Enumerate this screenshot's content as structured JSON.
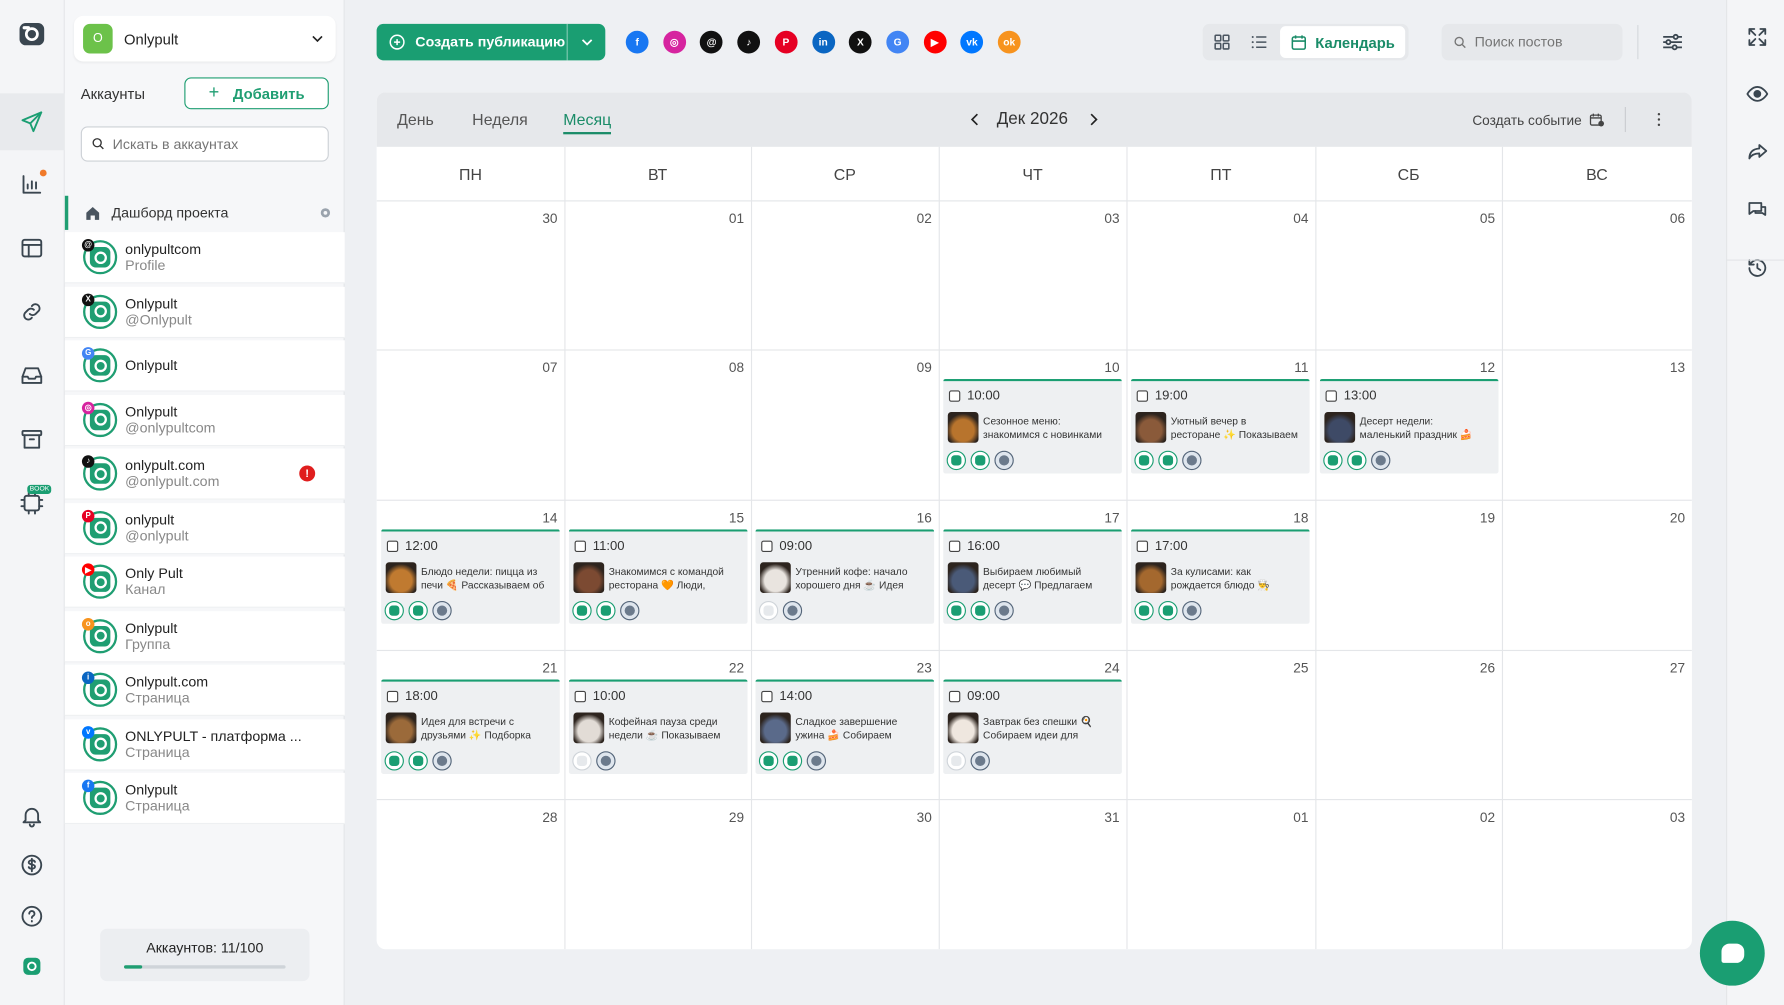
{
  "colors": {
    "accent": "#1a9e72",
    "warning": "#e01e1e"
  },
  "rail": {
    "items": [
      "logo-icon",
      "send-icon",
      "stats-icon",
      "layout-icon",
      "link-icon",
      "inbox-icon",
      "archive-icon",
      "ai-icon",
      "bell-icon",
      "dollar-icon",
      "help-icon",
      "app-icon"
    ],
    "ai_badge": "BOOK"
  },
  "project": {
    "name": "Onlypult",
    "avatar": "O"
  },
  "accounts_panel": {
    "label": "Аккаунты",
    "add_label": "Добавить",
    "search_placeholder": "Искать в аккаунтах",
    "dashboard_label": "Дашборд проекта",
    "items": [
      {
        "name": "onlypultcom",
        "sub": "Profile",
        "network": "threads"
      },
      {
        "name": "Onlypult",
        "sub": "@Onlypult",
        "network": "x"
      },
      {
        "name": "Onlypult",
        "sub": "",
        "network": "google"
      },
      {
        "name": "Onlypult",
        "sub": "@onlypultcom",
        "network": "instagram"
      },
      {
        "name": "onlypult.com",
        "sub": "@onlypult.com",
        "network": "tiktok",
        "warning": "!"
      },
      {
        "name": "onlypult",
        "sub": "@onlypult",
        "network": "pinterest"
      },
      {
        "name": "Only Pult",
        "sub": "Канал",
        "network": "youtube"
      },
      {
        "name": "Onlypult",
        "sub": "Группа",
        "network": "ok"
      },
      {
        "name": "Onlypult.com",
        "sub": "Страница",
        "network": "linkedin"
      },
      {
        "name": "ONLYPULT - платформа ...",
        "sub": "Страница",
        "network": "vk"
      },
      {
        "name": "Onlypult",
        "sub": "Страница",
        "network": "facebook"
      }
    ],
    "quota_label": "Аккаунтов: 11/100",
    "quota_fraction": 0.11
  },
  "toolbar": {
    "create_label": "Создать публикацию",
    "networks": [
      "facebook",
      "instagram",
      "threads",
      "tiktok",
      "pinterest",
      "linkedin",
      "x",
      "google",
      "youtube",
      "vk",
      "ok"
    ],
    "calendar_label": "Календарь",
    "search_placeholder": "Поиск постов"
  },
  "calendar": {
    "tabs": [
      "День",
      "Неделя",
      "Месяц"
    ],
    "active_tab": "Месяц",
    "month_label": "Дек 2026",
    "create_event_label": "Создать событие",
    "weekdays": [
      "ПН",
      "ВТ",
      "СР",
      "ЧТ",
      "ПТ",
      "СБ",
      "ВС"
    ],
    "weeks": [
      [
        "30",
        "01",
        "02",
        "03",
        "04",
        "05",
        "06"
      ],
      [
        "07",
        "08",
        "09",
        "10",
        "11",
        "12",
        "13"
      ],
      [
        "14",
        "15",
        "16",
        "17",
        "18",
        "19",
        "20"
      ],
      [
        "21",
        "22",
        "23",
        "24",
        "25",
        "26",
        "27"
      ],
      [
        "28",
        "29",
        "30",
        "31",
        "01",
        "02",
        "03"
      ]
    ],
    "posts": [
      {
        "week": 1,
        "day": 3,
        "time": "10:00",
        "text": "Сезонное меню: знакомимся с новинками 🍕 Пок...",
        "icons": [
          "g",
          "g",
          "owl"
        ]
      },
      {
        "week": 1,
        "day": 4,
        "time": "19:00",
        "text": "Уютный вечер в ресторане ✨ Показываем интер...",
        "icons": [
          "g",
          "g",
          "owl"
        ]
      },
      {
        "week": 1,
        "day": 5,
        "time": "13:00",
        "text": "Десерт недели: маленький праздник 🍰 Показыв...",
        "icons": [
          "g",
          "g",
          "owl"
        ]
      },
      {
        "week": 2,
        "day": 0,
        "time": "12:00",
        "text": "Блюдо недели: пицца из печи 🍕 Рассказываем об ...",
        "icons": [
          "g",
          "g",
          "owl"
        ]
      },
      {
        "week": 2,
        "day": 1,
        "time": "11:00",
        "text": "Знакомимся с командой ресторана 🧡 Люди, кото...",
        "icons": [
          "g",
          "g",
          "owl"
        ]
      },
      {
        "week": 2,
        "day": 2,
        "time": "09:00",
        "text": "Утренний кофе: начало хорошего дня ☕ Идея для...",
        "icons": [
          "logo",
          "owl"
        ]
      },
      {
        "week": 2,
        "day": 3,
        "time": "16:00",
        "text": "Выбираем любимый десерт 💬 Предлагаем гостя...",
        "icons": [
          "g",
          "g",
          "owl"
        ]
      },
      {
        "week": 2,
        "day": 4,
        "time": "17:00",
        "text": "За кулисами: как рождается блюдо 👨‍🍳 Рассказыв...",
        "icons": [
          "g",
          "g",
          "owl"
        ]
      },
      {
        "week": 3,
        "day": 0,
        "time": "18:00",
        "text": "Идея для встречи с друзьями ✨ Подборка уютны...",
        "icons": [
          "g",
          "g",
          "owl"
        ]
      },
      {
        "week": 3,
        "day": 1,
        "time": "10:00",
        "text": "Кофейная пауза среди недели ☕ Показываем лю...",
        "icons": [
          "logo",
          "owl"
        ]
      },
      {
        "week": 3,
        "day": 2,
        "time": "14:00",
        "text": "Сладкое завершение ужина 🍰 Собираем десерт...",
        "icons": [
          "g",
          "g",
          "owl"
        ]
      },
      {
        "week": 3,
        "day": 3,
        "time": "09:00",
        "text": "Завтрак без спешки 🍳 Собираем идеи для споко...",
        "icons": [
          "logo",
          "owl"
        ]
      }
    ]
  },
  "right_rail": [
    "expand-icon",
    "eye-icon",
    "share-icon",
    "comments-icon",
    "history-icon"
  ]
}
